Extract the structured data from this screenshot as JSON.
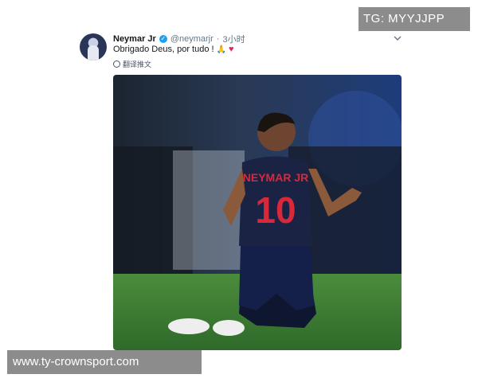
{
  "tweet": {
    "author_name": "Neymar Jr",
    "handle": "@neymarjr",
    "separator": "·",
    "time": "3小时",
    "text": "Obrigado Deus, por tudo !",
    "emoji_pray": "🙏",
    "emoji_heart": "♥",
    "translate_label": "翻译推文",
    "photo": {
      "jersey_name": "NEYMAR JR",
      "jersey_number": "10"
    }
  },
  "overlays": {
    "top_tag": "TG: MYYJJPP",
    "bottom_watermark": "www.ty-crownsport.com"
  },
  "colors": {
    "verified": "#1da1f2",
    "heart": "#e0245e",
    "overlay_bg": "#8c8c8c",
    "pitch": "#3e7d33",
    "jersey": "#1a2344",
    "number": "#d8283a"
  }
}
